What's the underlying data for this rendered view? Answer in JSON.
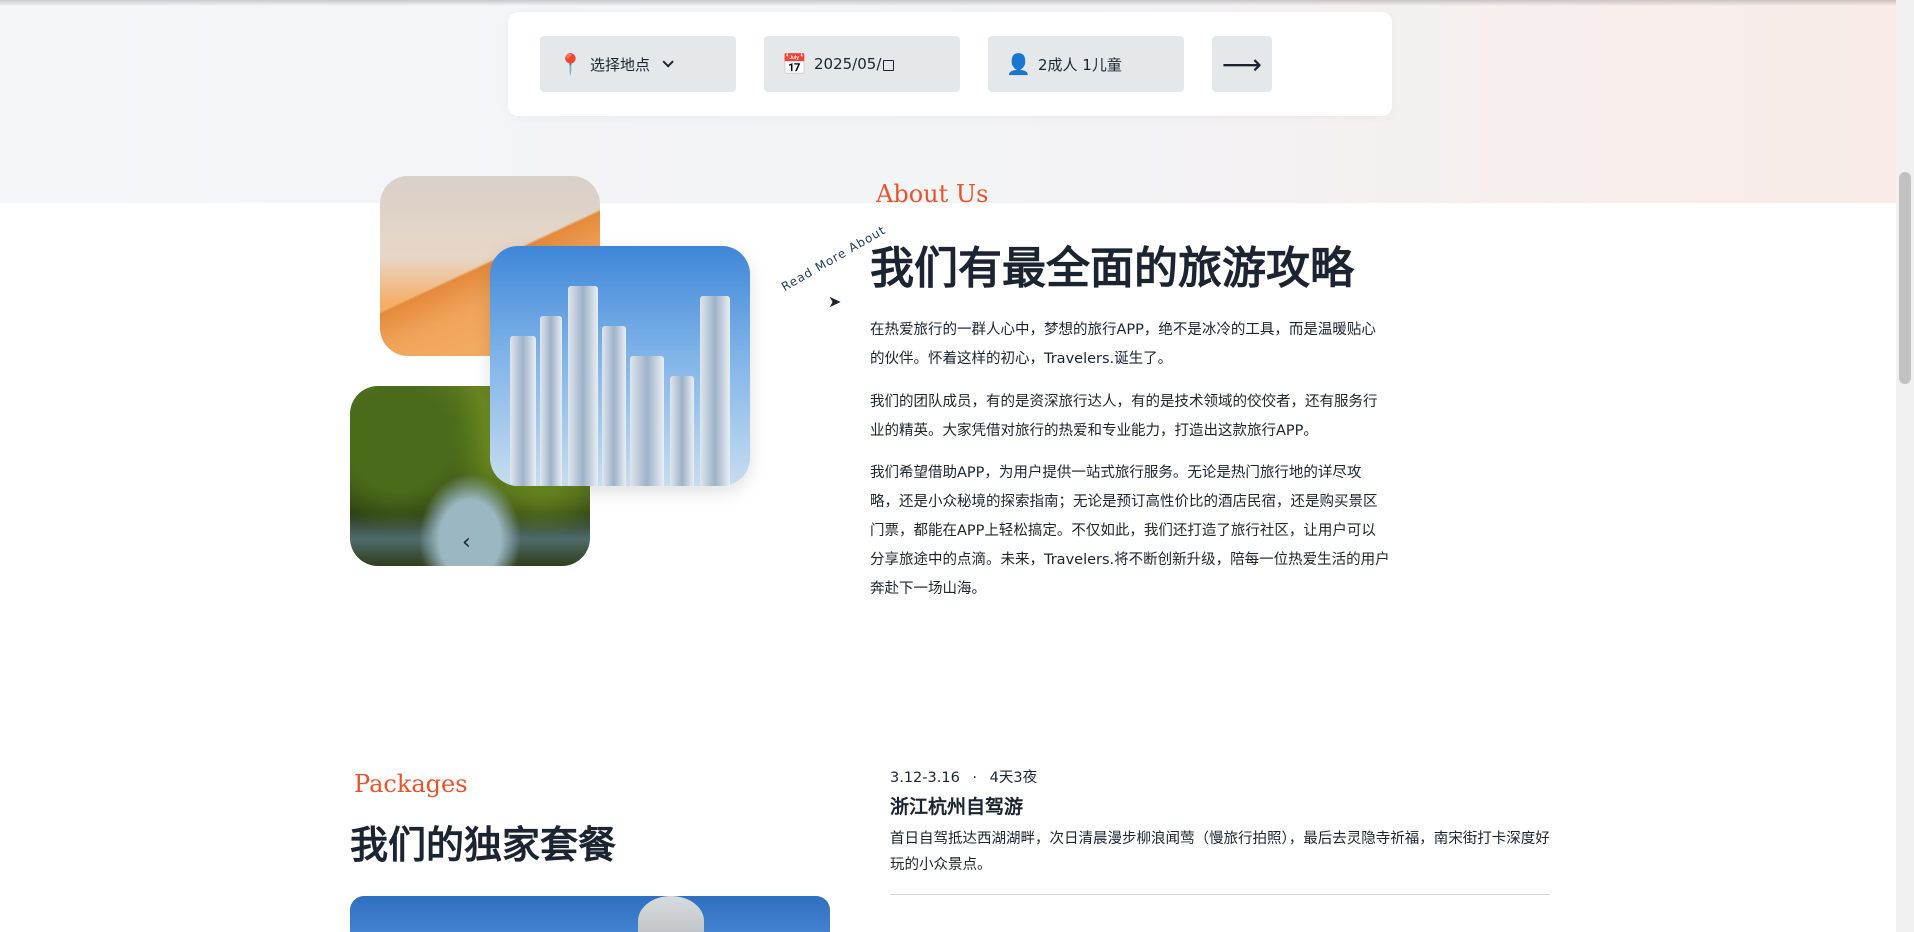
{
  "search": {
    "location_label": "选择地点",
    "date_value": "2025/05/",
    "guests_label": "2成人 1儿童",
    "submit_glyph": "⟶"
  },
  "about": {
    "eyebrow": "About Us",
    "heading": "我们有最全面的旅游攻略",
    "circle_text": "Read More About",
    "paragraphs": [
      "在热爱旅行的一群人心中，梦想的旅行APP，绝不是冰冷的工具，而是温暖贴心的伙伴。怀着这样的初心，Travelers.诞生了。",
      "我们的团队成员，有的是资深旅行达人，有的是技术领域的佼佼者，还有服务行业的精英。大家凭借对旅行的热爱和专业能力，打造出这款旅行APP。",
      "我们希望借助APP，为用户提供一站式旅行服务。无论是热门旅行地的详尽攻略，还是小众秘境的探索指南；无论是预订高性价比的酒店民宿，还是购买景区门票，都能在APP上轻松搞定。不仅如此，我们还打造了旅行社区，让用户可以分享旅途中的点滴。未来，Travelers.将不断创新升级，陪每一位热爱生活的用户奔赴下一场山海。"
    ]
  },
  "packages": {
    "eyebrow": "Packages",
    "heading": "我们的独家套餐",
    "items": [
      {
        "dates": "3.12-3.16",
        "separator": "·",
        "duration": "4天3夜",
        "title": "浙江杭州自驾游",
        "description": "首日自驾抵达西湖湖畔，次日清晨漫步柳浪闻莺（慢旅行拍照），最后去灵隐寺祈福，南宋街打卡深度好玩的小众景点。"
      }
    ]
  },
  "icons": {
    "location": "map-pin-icon",
    "calendar": "calendar-icon",
    "user": "user-icon",
    "arrow": "arrow-right-icon"
  },
  "colors": {
    "accent": "#e8542b",
    "text": "#1b2430",
    "field_bg": "#e4e8eb"
  }
}
